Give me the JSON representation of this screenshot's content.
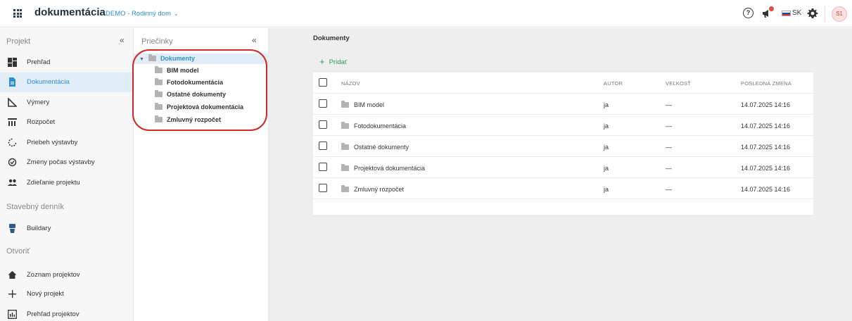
{
  "topbar": {
    "brand": "dokumentácia",
    "project": "DEMO - Rodinný dom",
    "language": "SK",
    "avatar_initials": "S1",
    "icons": [
      "apps-grid-icon",
      "help-icon",
      "announcement-icon",
      "flag-sk-icon",
      "gear-icon"
    ]
  },
  "sidebar": {
    "section_project": "Projekt",
    "items": [
      {
        "label": "Prehľad",
        "icon": "dashboard-icon"
      },
      {
        "label": "Dokumentácia",
        "icon": "document-icon"
      },
      {
        "label": "Výmery",
        "icon": "measure-icon"
      },
      {
        "label": "Rozpočet",
        "icon": "budget-icon"
      },
      {
        "label": "Priebeh výstavby",
        "icon": "progress-icon"
      },
      {
        "label": "Zmeny počas výstavby",
        "icon": "changes-icon"
      },
      {
        "label": "Zdieľanie projektu",
        "icon": "share-icon"
      }
    ],
    "section_diary": "Stavebný denník",
    "diary_items": [
      {
        "label": "Buildary",
        "icon": "buildary-icon"
      }
    ],
    "section_open": "Otvoriť",
    "open_items": [
      {
        "label": "Zoznam projektov",
        "icon": "home-icon"
      },
      {
        "label": "Nový projekt",
        "icon": "plus-icon"
      },
      {
        "label": "Prehľad projektov",
        "icon": "chart-icon"
      }
    ]
  },
  "folders": {
    "title": "Priečinky",
    "root": "Dokumenty",
    "children": [
      "BIM model",
      "Fotodokumentácia",
      "Ostatné dokumenty",
      "Projektová dokumentácia",
      "Zmluvný rozpočet"
    ]
  },
  "main": {
    "title": "Dokumenty",
    "add_label": "Pridať",
    "columns": {
      "name": "NÁZOV",
      "author": "AUTOR",
      "size": "VEĽKOSŤ",
      "date": "POSLEDNÁ ZMENA"
    },
    "rows": [
      {
        "name": "BIM model",
        "author": "ja",
        "size": "—",
        "date": "14.07.2025 14:16"
      },
      {
        "name": "Fotodokumentácia",
        "author": "ja",
        "size": "—",
        "date": "14.07.2025 14:16"
      },
      {
        "name": "Ostatné dokumenty",
        "author": "ja",
        "size": "—",
        "date": "14.07.2025 14:16"
      },
      {
        "name": "Projektová dokumentácia",
        "author": "ja",
        "size": "—",
        "date": "14.07.2025 14:16"
      },
      {
        "name": "Zmluvný rozpočet",
        "author": "ja",
        "size": "—",
        "date": "14.07.2025 14:16"
      }
    ]
  },
  "colors": {
    "accent": "#2a8fd0",
    "active_bg": "#e1edf7",
    "add_green": "#2e9b5c",
    "annotation_red": "#d42626"
  }
}
